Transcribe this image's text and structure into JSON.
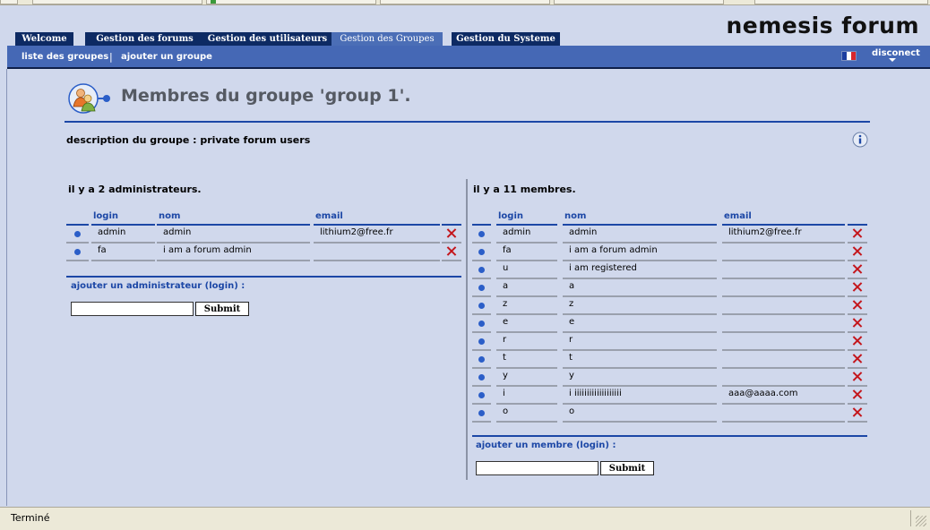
{
  "brand": "nemesis forum",
  "tabs": [
    {
      "label": "Welcome",
      "active": false
    },
    {
      "label": "Gestion des forums",
      "active": false
    },
    {
      "label": "Gestion des utilisateurs",
      "active": false
    },
    {
      "label": "Gestion des Groupes",
      "active": true
    },
    {
      "label": "Gestion du Systeme",
      "active": false
    }
  ],
  "subnav": {
    "list_groups": "liste des groupes",
    "separator": "|",
    "add_group": "ajouter un groupe",
    "disconnect": "disconect",
    "flag_colors": [
      "#1d3fa0",
      "#ffffff",
      "#d8262c"
    ]
  },
  "page": {
    "title": "Membres du groupe 'group 1'.",
    "description": "description du groupe : private forum users"
  },
  "admins": {
    "count_text": "il y a 2 administrateurs.",
    "headers": [
      "login",
      "nom",
      "email"
    ],
    "rows": [
      {
        "login": "admin",
        "nom": "admin",
        "email": "lithium2@free.fr"
      },
      {
        "login": "fa",
        "nom": "i am a forum admin",
        "email": ""
      }
    ],
    "add_label": "ajouter un administrateur (login) :",
    "submit": "Submit",
    "input_value": ""
  },
  "members": {
    "count_text": "il y a 11 membres.",
    "headers": [
      "login",
      "nom",
      "email"
    ],
    "rows": [
      {
        "login": "admin",
        "nom": "admin",
        "email": "lithium2@free.fr"
      },
      {
        "login": "fa",
        "nom": "i am a forum admin",
        "email": ""
      },
      {
        "login": "u",
        "nom": "i am registered",
        "email": ""
      },
      {
        "login": "a",
        "nom": "a",
        "email": ""
      },
      {
        "login": "z",
        "nom": "z",
        "email": ""
      },
      {
        "login": "e",
        "nom": "e",
        "email": ""
      },
      {
        "login": "r",
        "nom": "r",
        "email": ""
      },
      {
        "login": "t",
        "nom": "t",
        "email": ""
      },
      {
        "login": "y",
        "nom": "y",
        "email": ""
      },
      {
        "login": "i",
        "nom": "i iiiiiiiiiiiiiiiiiii",
        "email": "aaa@aaaa.com"
      },
      {
        "login": "o",
        "nom": "o",
        "email": ""
      }
    ],
    "add_label": "ajouter un membre (login) :",
    "submit": "Submit",
    "input_value": ""
  },
  "status": {
    "text": "Terminé"
  },
  "colors": {
    "accent": "#1c47a6",
    "nav": "#0d2a63",
    "subnav": "#4568b5",
    "delete": "#c4161c",
    "background": "#d0d8ec"
  },
  "icons": {
    "group": "group-users-icon",
    "info": "info-icon",
    "delete": "delete-x-icon",
    "bullet": "bullet-dot-icon"
  }
}
